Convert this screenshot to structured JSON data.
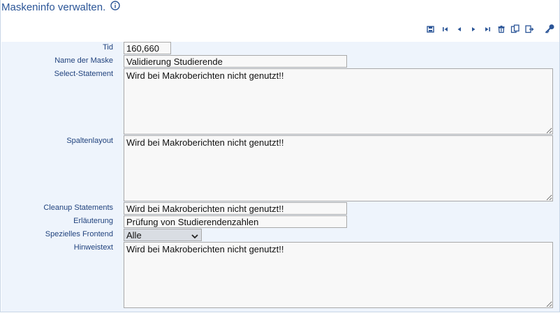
{
  "page": {
    "title": "Maskeninfo verwalten."
  },
  "toolbar": {
    "buttons": [
      "save-icon",
      "first-record-icon",
      "previous-record-icon",
      "next-record-icon",
      "last-record-icon",
      "delete-icon",
      "copy-icon",
      "export-icon",
      "key-icon"
    ]
  },
  "form": {
    "tid": {
      "label": "Tid",
      "value": "160,660"
    },
    "name": {
      "label": "Name der Maske",
      "value": "Validierung Studierende"
    },
    "select_statement": {
      "label": "Select-Statement",
      "value": "Wird bei Makroberichten nicht genutzt!!"
    },
    "spaltenlayout": {
      "label": "Spaltenlayout",
      "value": "Wird bei Makroberichten nicht genutzt!!"
    },
    "cleanup": {
      "label": "Cleanup Statements",
      "value": "Wird bei Makroberichten nicht genutzt!!"
    },
    "erlaeuterung": {
      "label": "Erläuterung",
      "value": "Prüfung von Studierendenzahlen"
    },
    "frontend": {
      "label": "Spezielles Frontend",
      "value": "Alle"
    },
    "hinweistext": {
      "label": "Hinweistext",
      "value": "Wird bei Makroberichten nicht genutzt!!"
    }
  },
  "colors": {
    "title": "#2b5597",
    "label": "#21437e",
    "form_bg": "#eef4fc"
  }
}
